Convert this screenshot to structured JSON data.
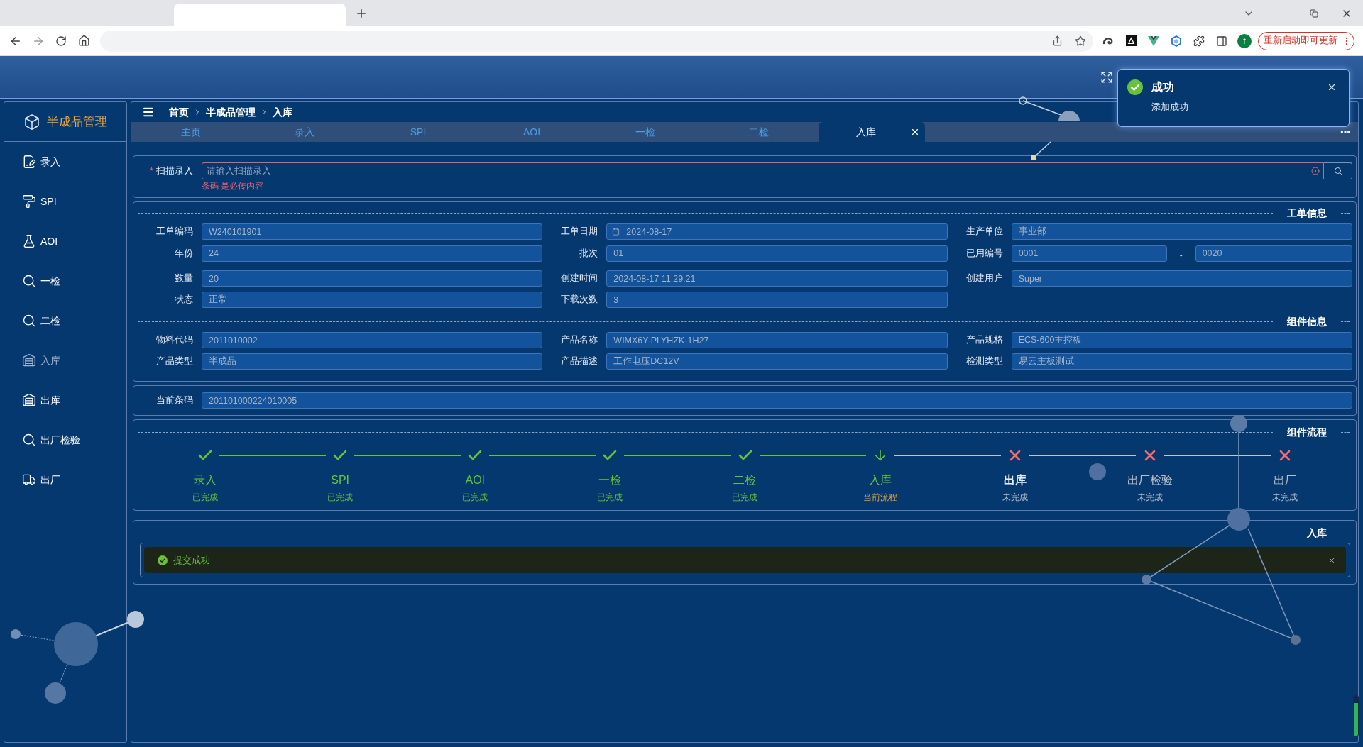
{
  "browser": {
    "profile_initial": "f",
    "update_button": "重新启动即可更新"
  },
  "sidebar": {
    "title": "半成品管理",
    "items": [
      {
        "label": "录入",
        "selected": false
      },
      {
        "label": "SPI",
        "selected": false
      },
      {
        "label": "AOI",
        "selected": false
      },
      {
        "label": "一检",
        "selected": false
      },
      {
        "label": "二检",
        "selected": false
      },
      {
        "label": "入库",
        "selected": true
      },
      {
        "label": "出库",
        "selected": false
      },
      {
        "label": "出厂检验",
        "selected": false
      },
      {
        "label": "出厂",
        "selected": false
      }
    ]
  },
  "breadcrumb": [
    "首页",
    "半成品管理",
    "入库"
  ],
  "tabs": [
    {
      "label": "主页",
      "selected": false
    },
    {
      "label": "录入",
      "selected": false
    },
    {
      "label": "SPI",
      "selected": false
    },
    {
      "label": "AOI",
      "selected": false
    },
    {
      "label": "一检",
      "selected": false
    },
    {
      "label": "二检",
      "selected": false
    },
    {
      "label": "入库",
      "selected": true
    }
  ],
  "scan": {
    "required_mark": "*",
    "label": "扫描录入",
    "placeholder": "请输入扫描录入",
    "error": "条码 是必传内容"
  },
  "info_sections": [
    {
      "title": "工单信息",
      "rows": [
        [
          {
            "kind": "text",
            "label": "工单编码",
            "value": "W240101901"
          },
          {
            "kind": "date",
            "label": "工单日期",
            "value": "2024-08-17"
          },
          {
            "kind": "text",
            "label": "生产单位",
            "value": "事业部"
          }
        ],
        [
          {
            "kind": "text",
            "label": "年份",
            "value": "24"
          },
          {
            "kind": "text",
            "label": "批次",
            "value": "01"
          },
          {
            "kind": "range",
            "label": "已用编号",
            "from": "0001",
            "separator": "-",
            "to": "0020"
          }
        ],
        [
          {
            "kind": "text",
            "label": "数量",
            "value": "20"
          },
          {
            "kind": "text",
            "label": "创建时间",
            "value": "2024-08-17 11:29:21"
          },
          {
            "kind": "text",
            "label": "创建用户",
            "value": "Super"
          }
        ],
        [
          {
            "kind": "text",
            "label": "状态",
            "value": "正常"
          },
          {
            "kind": "text",
            "label": "下载次数",
            "value": "3"
          }
        ]
      ]
    },
    {
      "title": "组件信息",
      "rows": [
        [
          {
            "kind": "text",
            "label": "物料代码",
            "value": "2011010002"
          },
          {
            "kind": "text",
            "label": "产品名称",
            "value": "WIMX6Y-PLYHZK-1H27"
          },
          {
            "kind": "text",
            "label": "产品规格",
            "value": "ECS-600主控板"
          }
        ],
        [
          {
            "kind": "text",
            "label": "产品类型",
            "value": "半成品"
          },
          {
            "kind": "text",
            "label": "产品描述",
            "value": "工作电压DC12V"
          },
          {
            "kind": "text",
            "label": "检测类型",
            "value": "易云主板测试"
          }
        ]
      ]
    }
  ],
  "current_barcode": {
    "label": "当前条码",
    "value": "201101000224010005"
  },
  "flow": {
    "title": "组件流程",
    "steps": [
      {
        "label": "录入",
        "kind": "done",
        "status_text": "已完成",
        "emphasized": false
      },
      {
        "label": "SPI",
        "kind": "done",
        "status_text": "已完成",
        "emphasized": false
      },
      {
        "label": "AOI",
        "kind": "done",
        "status_text": "已完成",
        "emphasized": false
      },
      {
        "label": "一检",
        "kind": "done",
        "status_text": "已完成",
        "emphasized": false
      },
      {
        "label": "二检",
        "kind": "done",
        "status_text": "已完成",
        "emphasized": false
      },
      {
        "label": "入库",
        "kind": "current",
        "status_text": "当前流程",
        "emphasized": false
      },
      {
        "label": "出库",
        "kind": "failed",
        "status_text": "未完成",
        "emphasized": true
      },
      {
        "label": "出厂检验",
        "kind": "failed",
        "status_text": "未完成",
        "emphasized": false
      },
      {
        "label": "出厂",
        "kind": "failed",
        "status_text": "未完成",
        "emphasized": false
      }
    ]
  },
  "entry": {
    "title": "入库",
    "alert": "提交成功"
  },
  "notification": {
    "title": "成功",
    "message": "添加成功"
  }
}
